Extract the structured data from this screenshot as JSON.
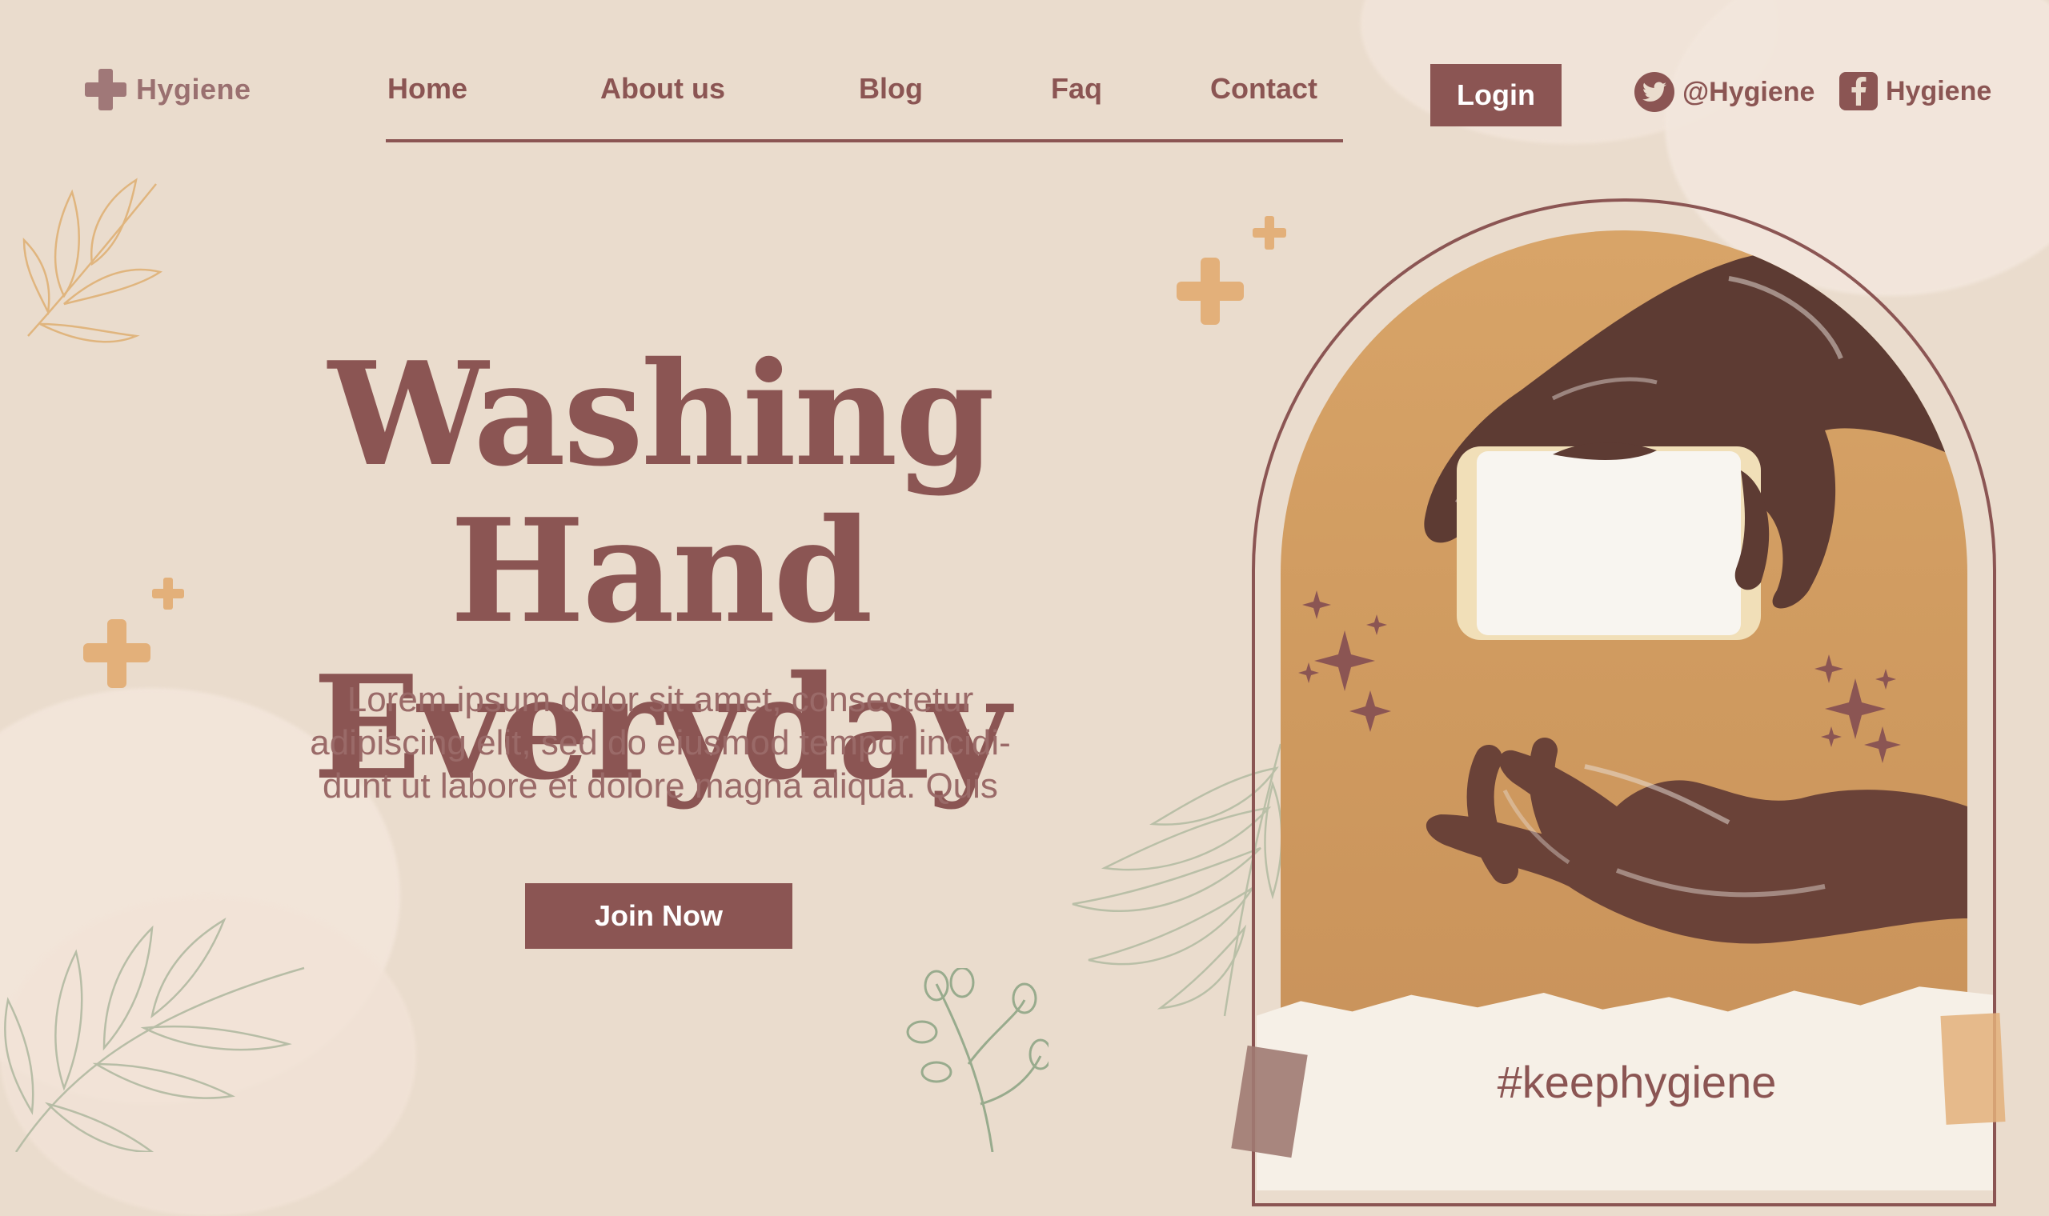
{
  "colors": {
    "background": "#eadccd",
    "brand": "#8b5553",
    "accent": "#e3b07a",
    "photo_bg": "#d4a063",
    "leaf": "#a8b39c"
  },
  "header": {
    "logo_text": "Hygiene",
    "logo_icon": "plus-icon",
    "nav": [
      {
        "label": "Home"
      },
      {
        "label": "About us"
      },
      {
        "label": "Blog"
      },
      {
        "label": "Faq"
      },
      {
        "label": "Contact"
      }
    ],
    "login_label": "Login",
    "social": {
      "twitter": {
        "icon": "twitter-icon",
        "handle": "@Hygiene"
      },
      "facebook": {
        "icon": "facebook-icon",
        "handle": "Hygiene"
      }
    }
  },
  "hero": {
    "title_line1": "Washing Hand",
    "title_line2": "Everyday",
    "description_lines": [
      "Lorem ipsum dolor sit amet, consectetur",
      "adipiscing elit, sed do eiusmod tempor incidi-",
      "dunt ut labore et dolore magna aliqua. Quis"
    ],
    "cta_label": "Join Now"
  },
  "photo": {
    "hashtag": "#keephygiene"
  }
}
